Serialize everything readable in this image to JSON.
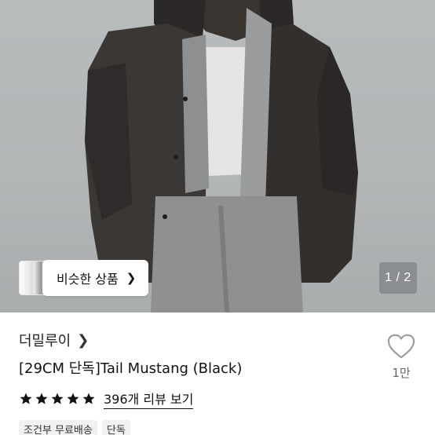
{
  "product": {
    "image_alt_icon": "product-photo",
    "similar_button_label": "비슷한 상품",
    "pager_text": "1 / 2",
    "brand": "더밀루이",
    "title": "[29CM 단독]Tail Mustang (Black)",
    "rating_stars": 5,
    "reviews_link": "396개 리뷰 보기",
    "like_count": "1만",
    "tags": [
      "조건부 무료배송",
      "단독"
    ]
  },
  "colors": {
    "star": "#111111",
    "tag_bg": "#f1f1f3",
    "pager_bg": "#828486"
  }
}
